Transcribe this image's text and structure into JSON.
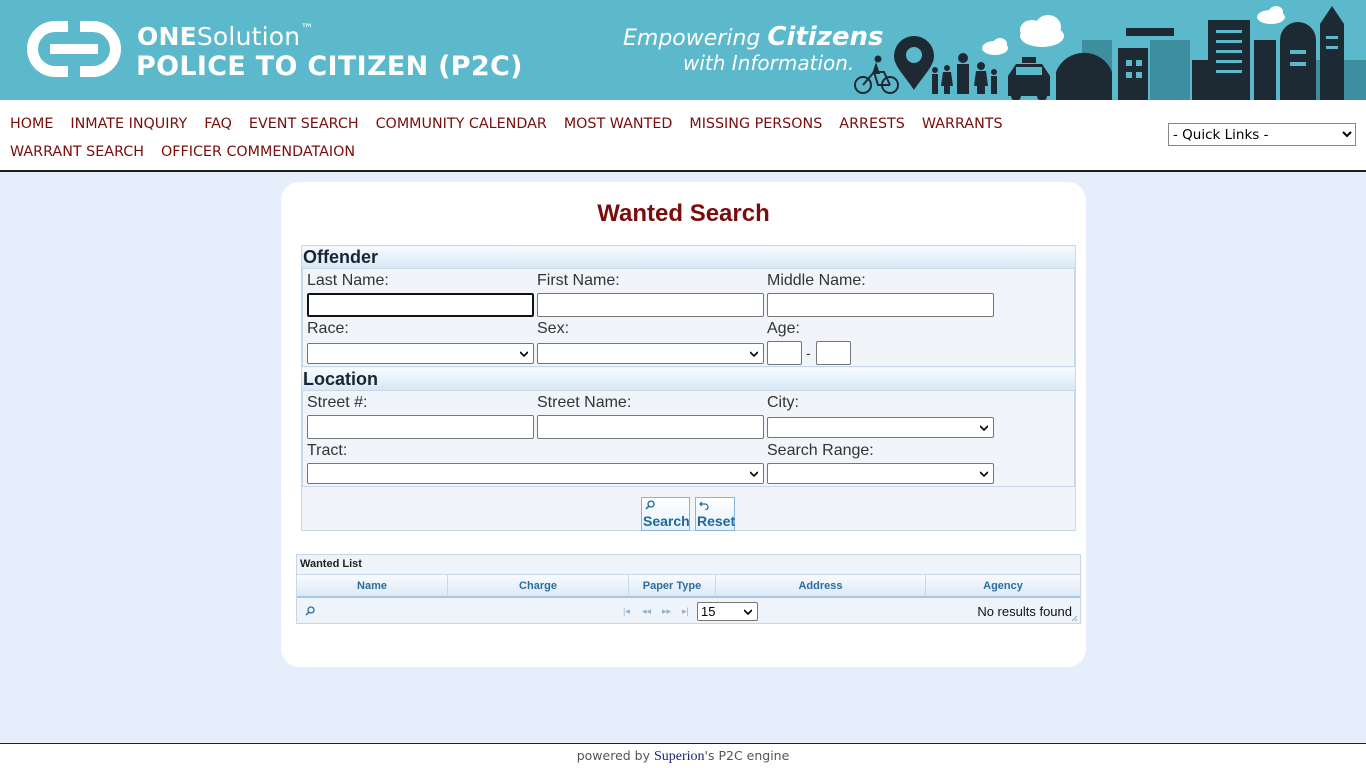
{
  "header": {
    "brand_one": "ONE",
    "brand_solution": "Solution",
    "brand_tm": "™",
    "brand_product": "POLICE TO CITIZEN (P2C)",
    "tagline_empowering": "Empowering",
    "tagline_citizens": "Citizens",
    "tagline_info": "with Information."
  },
  "nav": {
    "items": [
      {
        "label": "HOME"
      },
      {
        "label": "INMATE INQUIRY"
      },
      {
        "label": "FAQ"
      },
      {
        "label": "EVENT SEARCH"
      },
      {
        "label": "COMMUNITY CALENDAR"
      },
      {
        "label": "MOST WANTED"
      },
      {
        "label": "MISSING PERSONS"
      },
      {
        "label": "ARRESTS"
      },
      {
        "label": "WARRANTS"
      },
      {
        "label": "WARRANT SEARCH"
      },
      {
        "label": "OFFICER COMMENDATAION"
      }
    ],
    "quick_links": "- Quick Links -"
  },
  "page": {
    "title": "Wanted Search"
  },
  "form": {
    "offender_heading": "Offender",
    "last_name_label": "Last Name:",
    "first_name_label": "First Name:",
    "middle_name_label": "Middle Name:",
    "race_label": "Race:",
    "sex_label": "Sex:",
    "age_label": "Age:",
    "age_separator": "-",
    "location_heading": "Location",
    "street_num_label": "Street #:",
    "street_name_label": "Street Name:",
    "city_label": "City:",
    "tract_label": "Tract:",
    "search_range_label": "Search Range:",
    "search_button": "Search",
    "reset_button": "Reset"
  },
  "grid": {
    "caption": "Wanted List",
    "columns": [
      "Name",
      "Charge",
      "Paper Type",
      "Address",
      "Agency"
    ],
    "page_size": "15",
    "empty_message": "No results found"
  },
  "footer": {
    "prefix": "powered by",
    "vendor": "Superion",
    "suffix": "'s P2C engine"
  },
  "colors": {
    "banner": "#5cb9cb",
    "nav_link": "#7a0c0c",
    "page_bg": "#e7eefb"
  }
}
